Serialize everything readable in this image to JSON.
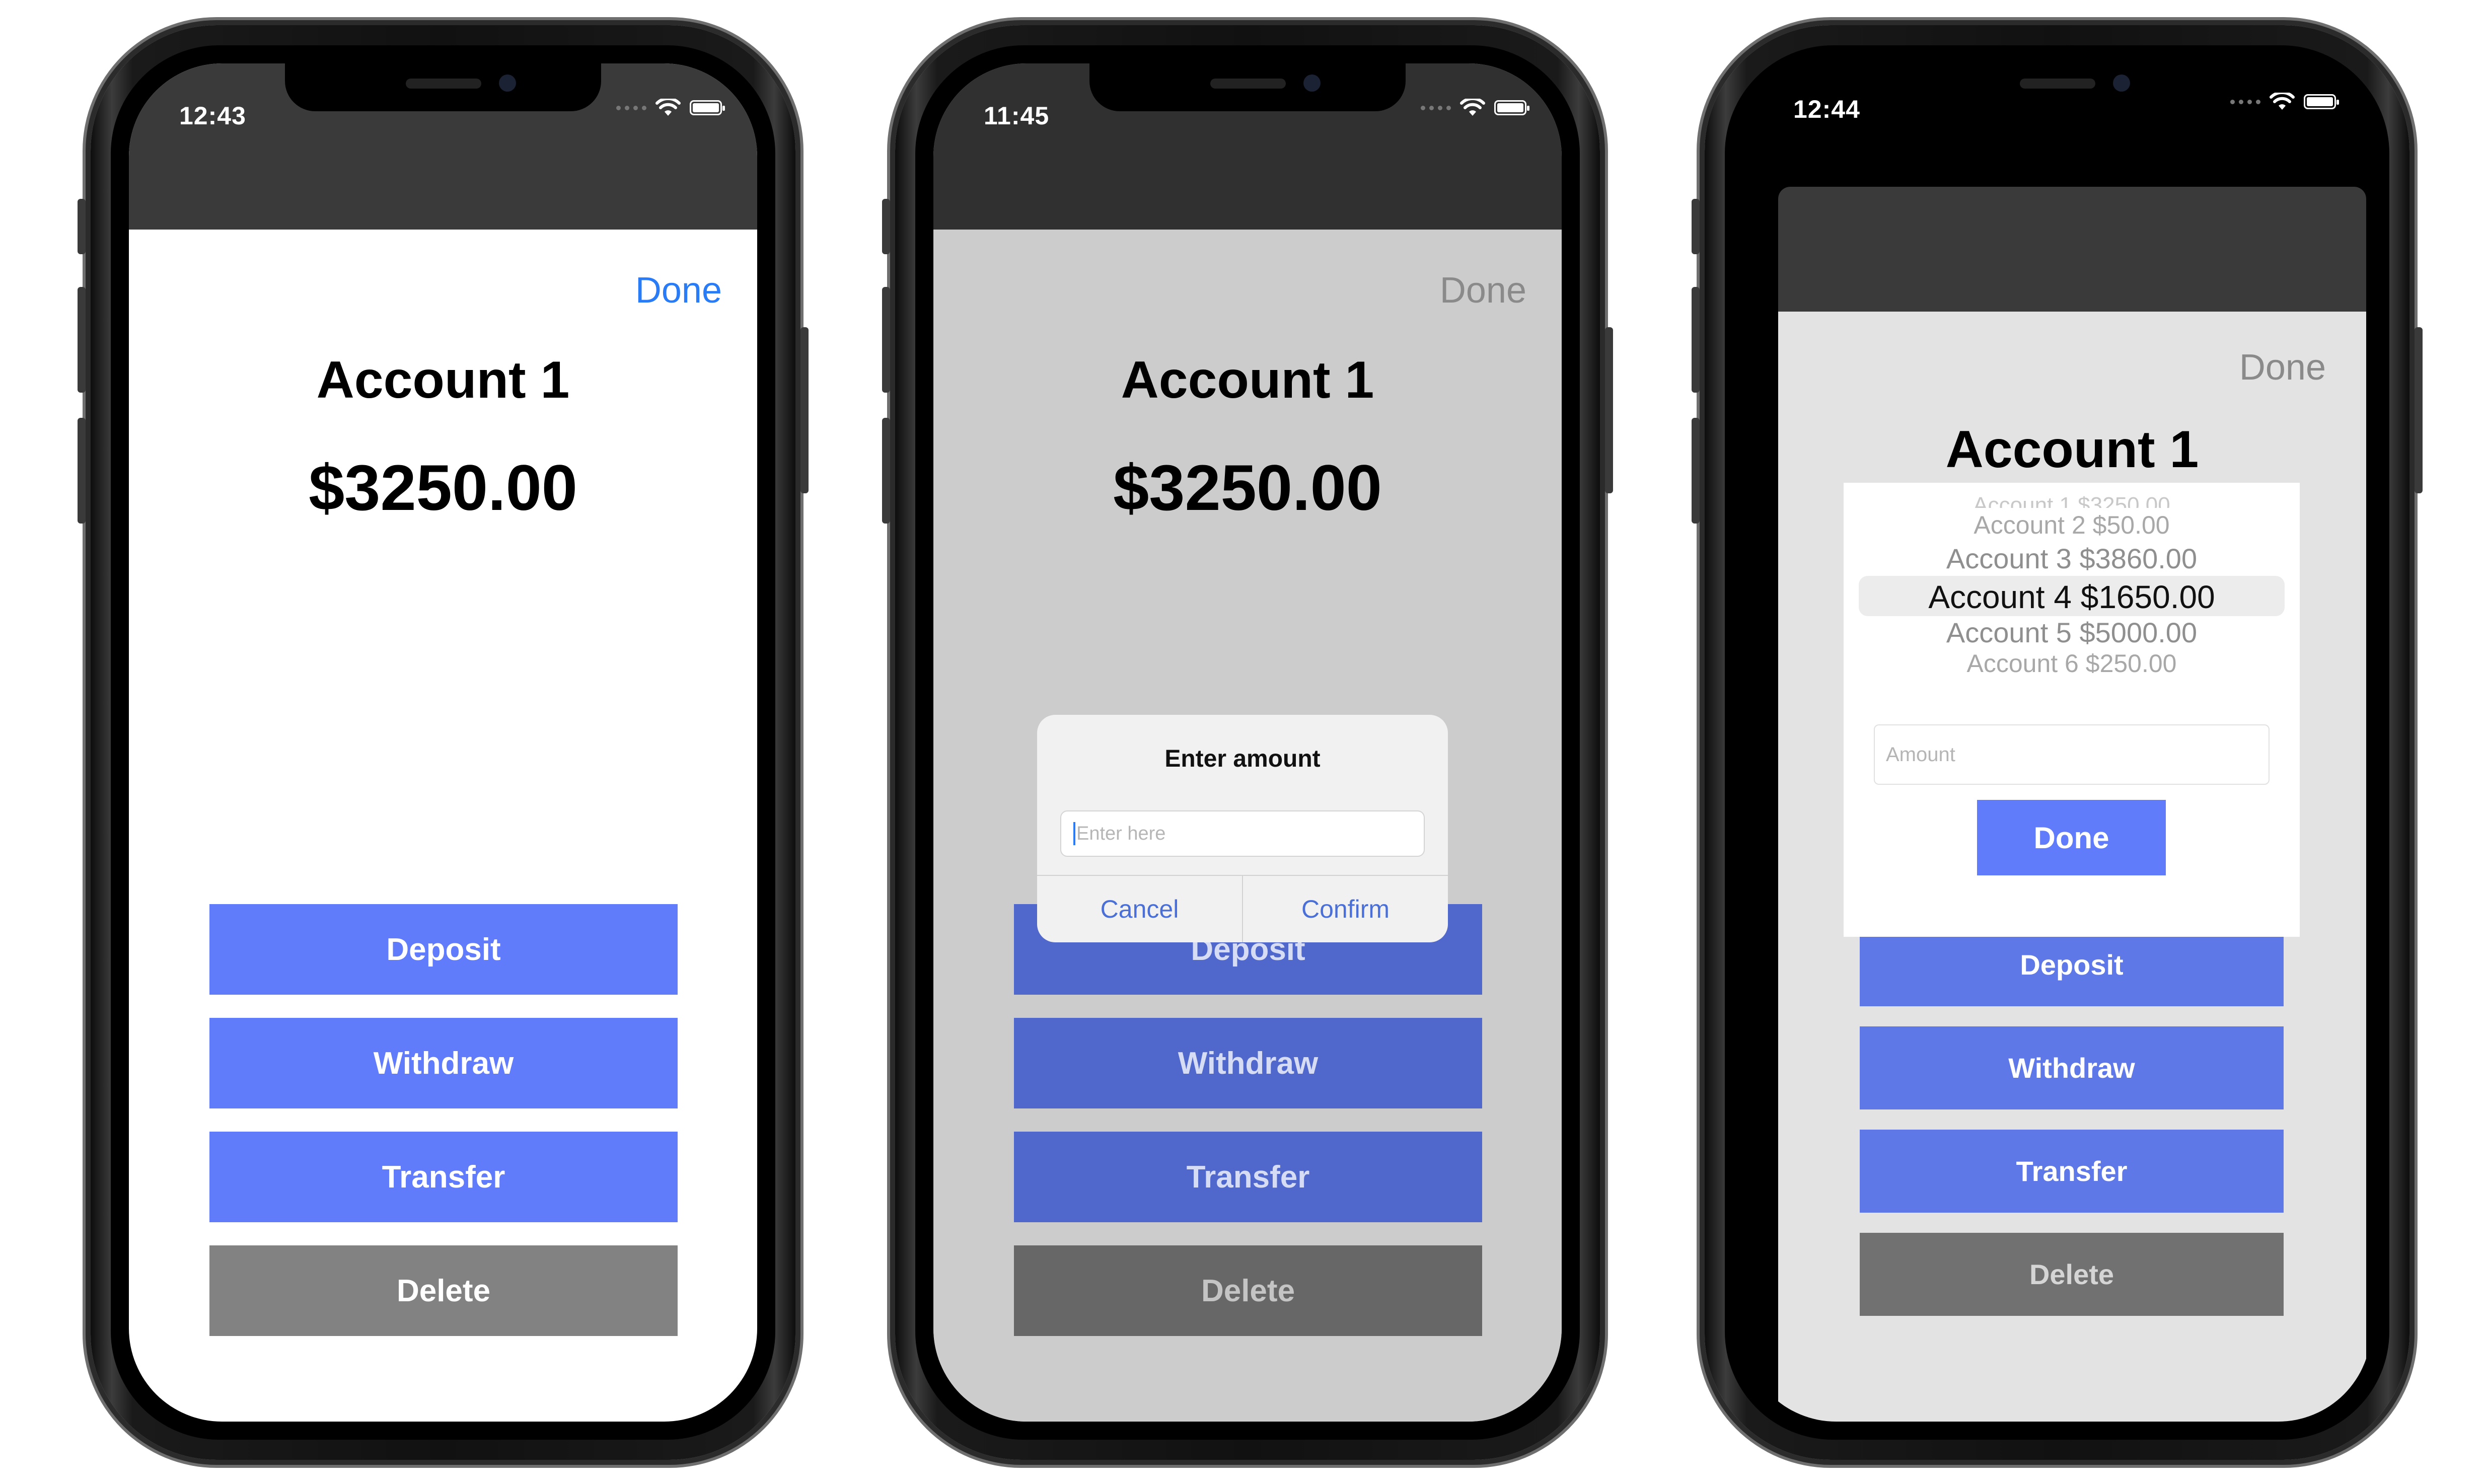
{
  "phones": [
    {
      "time": "12:43",
      "done_label": "Done",
      "account_title": "Account 1",
      "balance": "$3250.00",
      "buttons": {
        "deposit": "Deposit",
        "withdraw": "Withdraw",
        "transfer": "Transfer",
        "delete": "Delete"
      }
    },
    {
      "time": "11:45",
      "done_label": "Done",
      "account_title": "Account 1",
      "balance": "$3250.00",
      "buttons": {
        "deposit": "Deposit",
        "withdraw": "Withdraw",
        "transfer": "Transfer",
        "delete": "Delete"
      },
      "alert": {
        "title": "Enter amount",
        "input_placeholder": "Enter here",
        "cancel_label": "Cancel",
        "confirm_label": "Confirm"
      }
    },
    {
      "time": "12:44",
      "done_label": "Done",
      "account_title": "Account 1",
      "buttons": {
        "deposit": "Deposit",
        "withdraw": "Withdraw",
        "transfer": "Transfer",
        "delete": "Delete"
      },
      "picker": {
        "options": [
          "Account 1 $3250.00",
          "Account 2 $50.00",
          "Account 3 $3860.00",
          "Account 4 $1650.00",
          "Account 5 $5000.00",
          "Account 6 $250.00"
        ],
        "selected": "Account 4 $1650.00"
      },
      "amount_placeholder": "Amount",
      "popup_done_label": "Done"
    }
  ],
  "colors": {
    "accent": "#617cfb",
    "link": "#2a7cf6",
    "delete": "#828282",
    "dim_overlay": "#cccccc"
  },
  "icons": [
    "wifi-icon",
    "battery-icon",
    "signal-dots-icon"
  ]
}
